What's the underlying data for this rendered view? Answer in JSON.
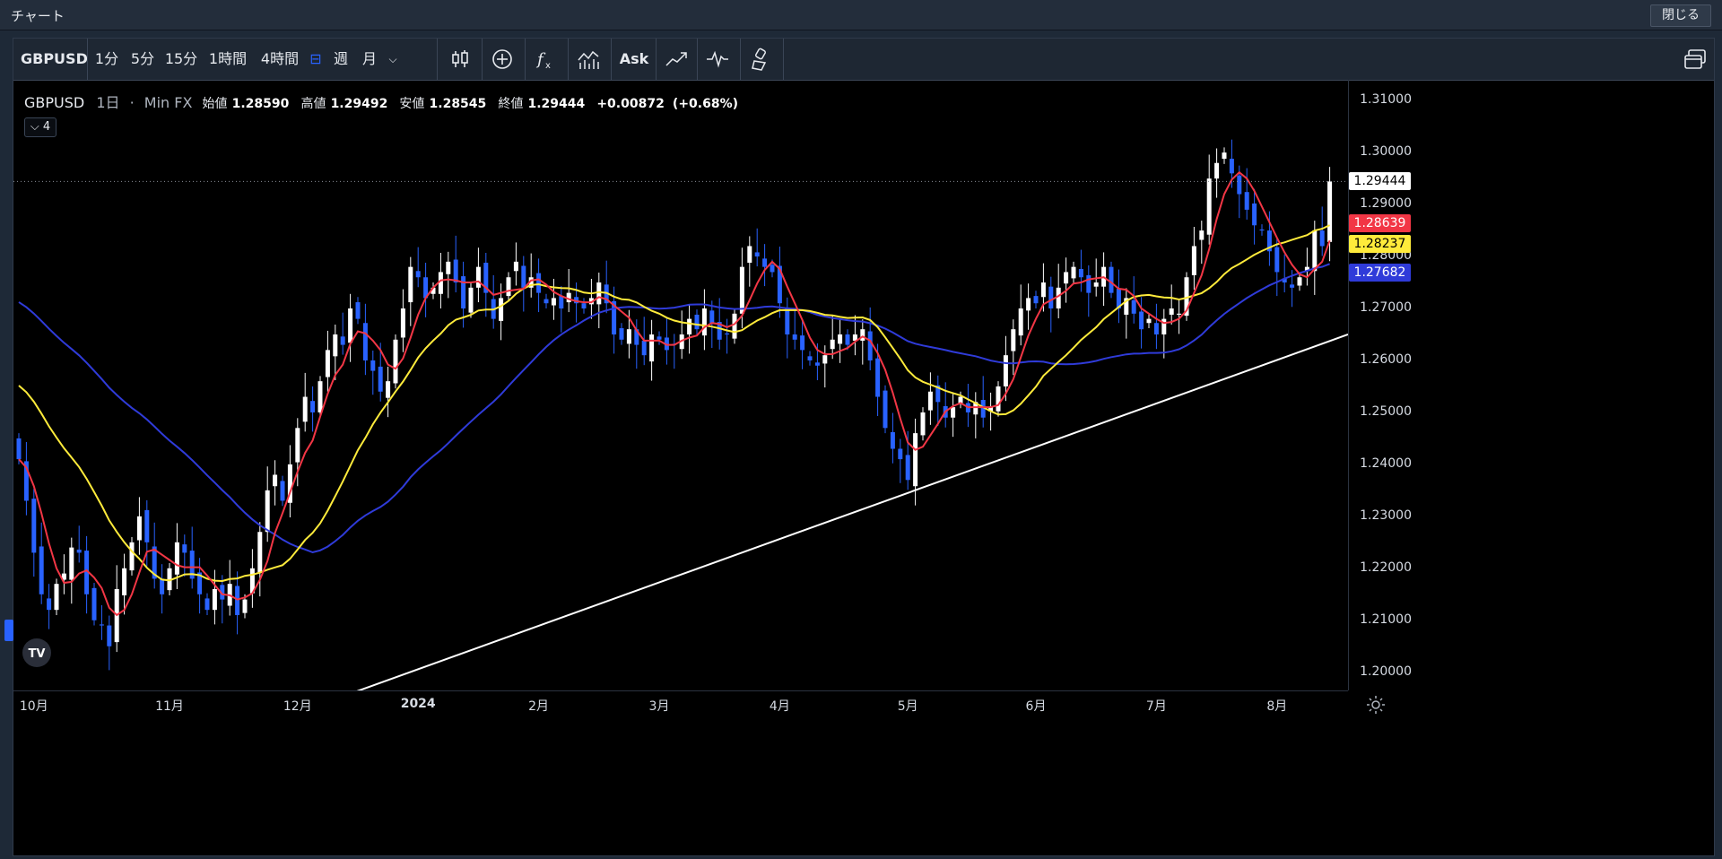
{
  "window": {
    "title": "チャート",
    "close_label": "閉じる"
  },
  "toolbar": {
    "symbol": "GBPUSD",
    "intervals": [
      "1分",
      "5分",
      "15分",
      "1時間",
      "4時間"
    ],
    "intervals_more": [
      "週",
      "月"
    ],
    "ask_label": "Ask"
  },
  "legend": {
    "symbol": "GBPUSD",
    "interval": "1日",
    "source": "Min FX",
    "open_label": "始値",
    "open": "1.28590",
    "high_label": "高値",
    "high": "1.29492",
    "low_label": "安値",
    "low": "1.28545",
    "close_label": "終値",
    "close": "1.29444",
    "change": "+0.00872",
    "change_pct": "(+0.68%)",
    "indicators_count": "4"
  },
  "price_axis": {
    "ticks": [
      "1.31000",
      "1.30000",
      "1.29000",
      "1.28000",
      "1.27000",
      "1.26000",
      "1.25000",
      "1.24000",
      "1.23000",
      "1.22000",
      "1.21000",
      "1.20000"
    ],
    "badges": [
      {
        "label": "1.29444",
        "value": 1.29444,
        "bg": "#ffffff",
        "fg": "#000000"
      },
      {
        "label": "1.28639",
        "value": 1.28639,
        "bg": "#f23645",
        "fg": "#ffffff"
      },
      {
        "label": "1.28237",
        "value": 1.28237,
        "bg": "#ffeb3b",
        "fg": "#000000"
      },
      {
        "label": "1.27682",
        "value": 1.27682,
        "bg": "#2f3bd9",
        "fg": "#ffffff"
      }
    ]
  },
  "time_axis": {
    "labels": [
      "10月",
      "11月",
      "12月",
      "2024",
      "2月",
      "3月",
      "4月",
      "5月",
      "6月",
      "7月",
      "8月"
    ]
  },
  "chart_data": {
    "type": "candlestick",
    "symbol": "GBPUSD",
    "interval": "1日",
    "ylim": [
      1.1965,
      1.314
    ],
    "last_price": 1.29444,
    "up_color": "#ffffff",
    "down_color": "#2962ff",
    "series_colors": {
      "ma_short": "#f23645",
      "ma_mid": "#ffeb3b",
      "ma_long": "#2f3bd9",
      "trendline": "#ffffff"
    },
    "closes": [
      1.241,
      1.233,
      1.223,
      1.215,
      1.212,
      1.217,
      1.219,
      1.224,
      1.223,
      1.215,
      1.21,
      1.209,
      1.205,
      1.216,
      1.22,
      1.225,
      1.23,
      1.225,
      1.218,
      1.215,
      1.22,
      1.225,
      1.223,
      1.218,
      1.215,
      1.212,
      1.216,
      1.214,
      1.217,
      1.211,
      1.214,
      1.22,
      1.227,
      1.235,
      1.238,
      1.233,
      1.24,
      1.247,
      1.253,
      1.25,
      1.256,
      1.262,
      1.265,
      1.263,
      1.27,
      1.268,
      1.26,
      1.258,
      1.254,
      1.256,
      1.264,
      1.27,
      1.278,
      1.276,
      1.272,
      1.274,
      1.277,
      1.279,
      1.275,
      1.27,
      1.274,
      1.278,
      1.273,
      1.268,
      1.272,
      1.276,
      1.279,
      1.274,
      1.276,
      1.273,
      1.271,
      1.272,
      1.27,
      1.273,
      1.271,
      1.27,
      1.272,
      1.275,
      1.271,
      1.265,
      1.264,
      1.266,
      1.263,
      1.261,
      1.265,
      1.264,
      1.262,
      1.263,
      1.265,
      1.268,
      1.266,
      1.27,
      1.267,
      1.264,
      1.265,
      1.269,
      1.278,
      1.282,
      1.28,
      1.278,
      1.277,
      1.271,
      1.265,
      1.264,
      1.262,
      1.26,
      1.259,
      1.261,
      1.264,
      1.265,
      1.263,
      1.265,
      1.266,
      1.26,
      1.253,
      1.247,
      1.243,
      1.241,
      1.237,
      1.246,
      1.25,
      1.254,
      1.252,
      1.249,
      1.251,
      1.253,
      1.25,
      1.252,
      1.249,
      1.251,
      1.255,
      1.261,
      1.266,
      1.27,
      1.272,
      1.271,
      1.275,
      1.27,
      1.274,
      1.277,
      1.278,
      1.276,
      1.273,
      1.275,
      1.278,
      1.273,
      1.27,
      1.272,
      1.269,
      1.266,
      1.268,
      1.265,
      1.268,
      1.27,
      1.269,
      1.276,
      1.282,
      1.285,
      1.295,
      1.298,
      1.3,
      1.296,
      1.292,
      1.289,
      1.286,
      1.285,
      1.281,
      1.277,
      1.275,
      1.274,
      1.276,
      1.278,
      1.285,
      1.282,
      1.29444
    ]
  }
}
